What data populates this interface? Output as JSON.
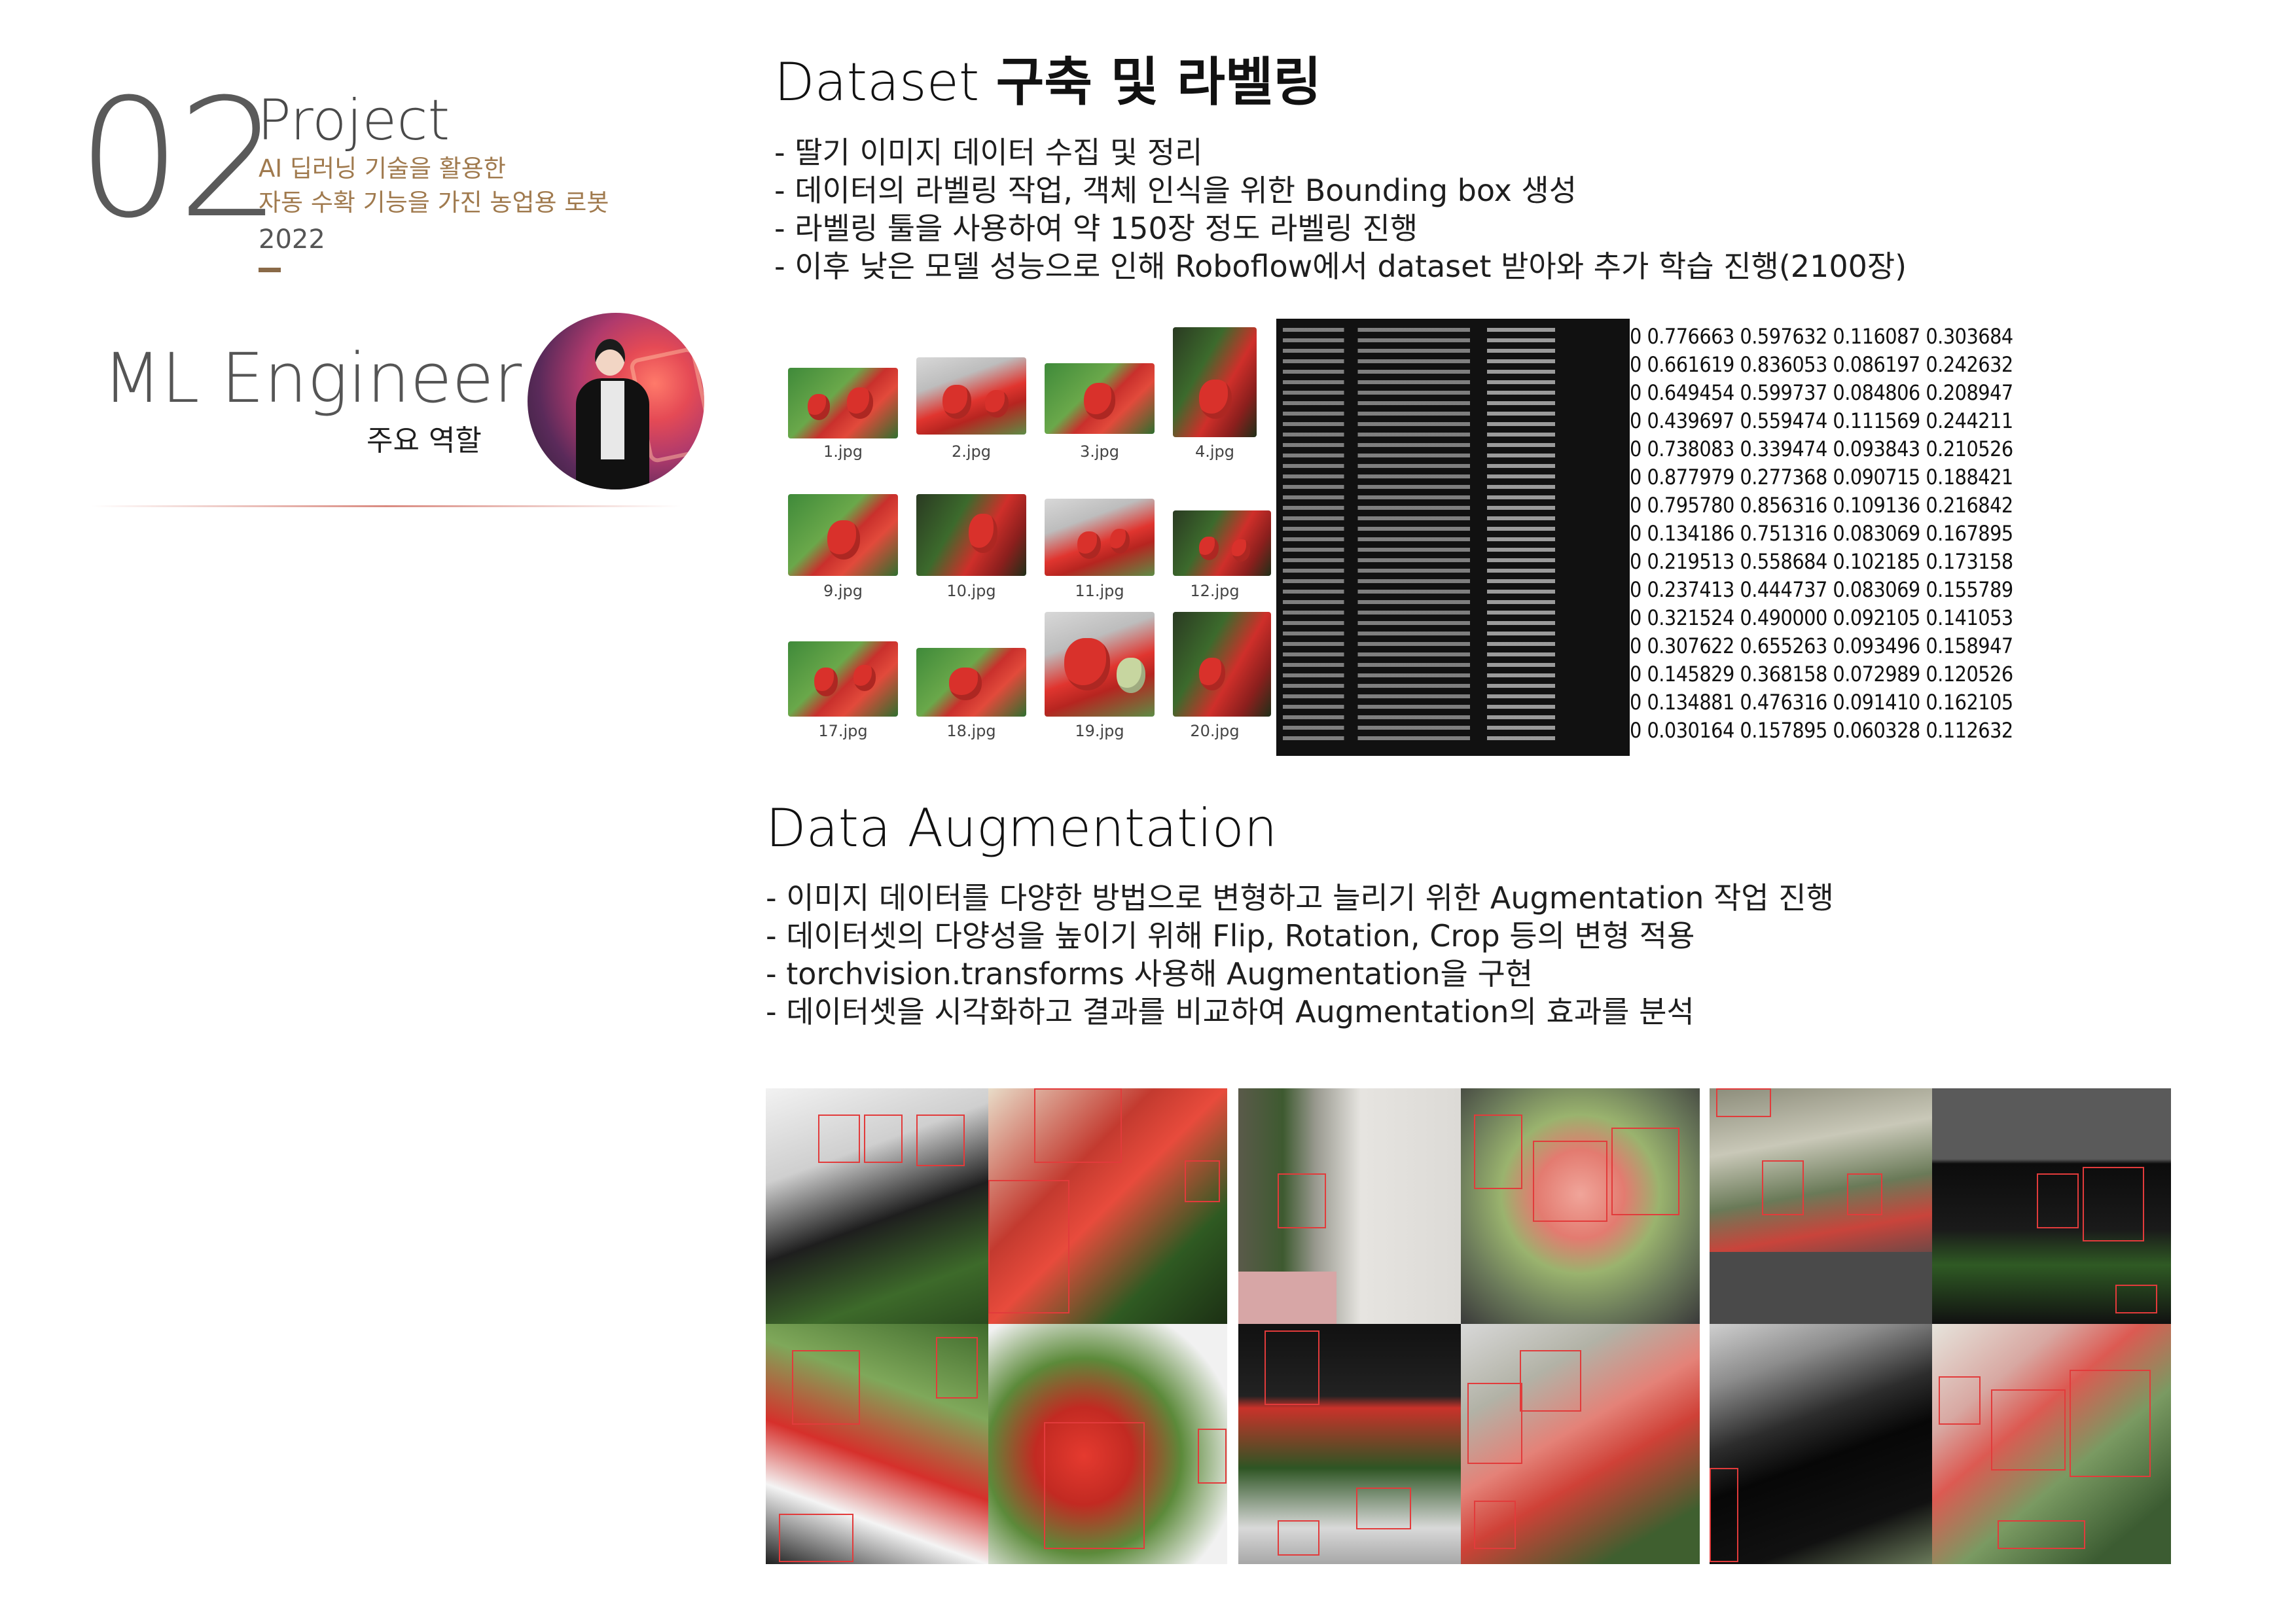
{
  "header": {
    "number": "02",
    "project_label": "Project",
    "subtitle_line1": "AI 딥러닝 기술을 활용한",
    "subtitle_line2": "자동 수확 기능을 가진 농업용 로봇",
    "year": "2022"
  },
  "role": {
    "title": "ML Engineer",
    "subtitle": "주요 역할"
  },
  "dataset_section": {
    "title_latin": "Dataset ",
    "title_korean": "구축 및 라벨링",
    "bullets": [
      "- 딸기 이미지 데이터 수집 및 정리",
      "- 데이터의 라벨링 작업, 객체 인식을 위한 Bounding box 생성",
      "- 라벨링 툴을 사용하여 약 150장 정도 라벨링 진행",
      "- 이후 낮은 모델 성능으로 인해 Roboflow에서 dataset 받아와 추가 학습 진행(2100장)"
    ],
    "thumbnails": [
      "1.jpg",
      "2.jpg",
      "3.jpg",
      "4.jpg",
      "9.jpg",
      "10.jpg",
      "11.jpg",
      "12.jpg",
      "17.jpg",
      "18.jpg",
      "19.jpg",
      "20.jpg"
    ],
    "label_rows": [
      "0 0.776663 0.597632 0.116087 0.303684",
      "0 0.661619 0.836053 0.086197 0.242632",
      "0 0.649454 0.599737 0.084806 0.208947",
      "0 0.439697 0.559474 0.111569 0.244211",
      "0 0.738083 0.339474 0.093843 0.210526",
      "0 0.877979 0.277368 0.090715 0.188421",
      "0 0.795780 0.856316 0.109136 0.216842",
      "0 0.134186 0.751316 0.083069 0.167895",
      "0 0.219513 0.558684 0.102185 0.173158",
      "0 0.237413 0.444737 0.083069 0.155789",
      "0 0.321524 0.490000 0.092105 0.141053",
      "0 0.307622 0.655263 0.093496 0.158947",
      "0 0.145829 0.368158 0.072989 0.120526",
      "0 0.134881 0.476316 0.091410 0.162105",
      "0 0.030164 0.157895 0.060328 0.112632"
    ]
  },
  "augmentation_section": {
    "title": "Data Augmentation",
    "bullets": [
      "- 이미지 데이터를 다양한 방법으로 변형하고 늘리기 위한 Augmentation 작업 진행",
      "- 데이터셋의 다양성을 높이기 위해 Flip, Rotation, Crop 등의 변형 적용",
      "- torchvision.transforms 사용해 Augmentation을 구현",
      "- 데이터셋을 시각화하고 결과를 비교하여 Augmentation의 효과를 분석"
    ]
  },
  "colors": {
    "accent_brown": "#a07a4e",
    "number_gray": "#5a5a5a",
    "bbox_red": "#e23b3b"
  }
}
